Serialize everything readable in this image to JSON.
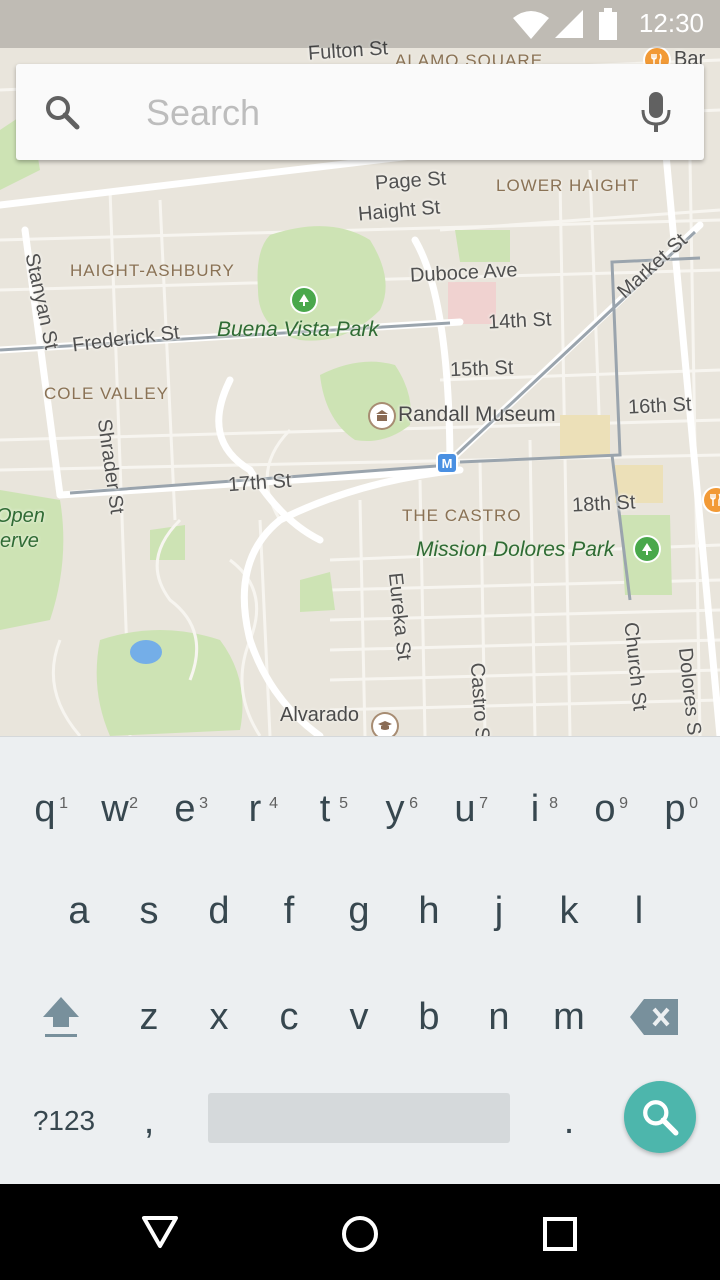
{
  "status_bar": {
    "time": "12:30",
    "icons": [
      "wifi-icon",
      "cell-signal-icon",
      "battery-icon"
    ]
  },
  "search": {
    "placeholder": "Search",
    "icons": [
      "search-icon",
      "mic-icon"
    ]
  },
  "map": {
    "streets": {
      "fulton": "Fulton St",
      "page": "Page St",
      "haight": "Haight St",
      "duboce": "Duboce Ave",
      "market": "Market St",
      "frederick": "Frederick St",
      "stanyan": "Stanyan St",
      "st14": "14th St",
      "st15": "15th St",
      "st16": "16th St",
      "st17": "17th St",
      "st18": "18th St",
      "shrader": "Shrader St",
      "eureka": "Eureka St",
      "castro": "Castro S",
      "church": "Church St",
      "dolores": "Dolores S"
    },
    "neighborhoods": {
      "alamo": "ALAMO SQUARE",
      "lower_haight": "LOWER HAIGHT",
      "haight_ashbury": "HAIGHT-ASHBURY",
      "cole_valley": "COLE VALLEY",
      "the_castro": "THE CASTRO"
    },
    "parks": {
      "buena_vista": "Buena Vista Park",
      "mission_dolores": "Mission Dolores Park"
    },
    "places": {
      "randall": "Randall Museum",
      "alvarado": "Alvarado",
      "bar": "Bar",
      "open_reserve_1": "Open",
      "open_reserve_2": "erve"
    },
    "colors": {
      "land": "#e9e5dc",
      "park": "#cde3b4",
      "water": "#74aee8",
      "road": "#ffffff",
      "pin_green": "#49a84b",
      "pin_orange": "#f29a36"
    }
  },
  "keyboard": {
    "row1": [
      {
        "label": "q",
        "hint": "1"
      },
      {
        "label": "w",
        "hint": "2"
      },
      {
        "label": "e",
        "hint": "3"
      },
      {
        "label": "r",
        "hint": "4"
      },
      {
        "label": "t",
        "hint": "5"
      },
      {
        "label": "y",
        "hint": "6"
      },
      {
        "label": "u",
        "hint": "7"
      },
      {
        "label": "i",
        "hint": "8"
      },
      {
        "label": "o",
        "hint": "9"
      },
      {
        "label": "p",
        "hint": "0"
      }
    ],
    "row2": [
      "a",
      "s",
      "d",
      "f",
      "g",
      "h",
      "j",
      "k",
      "l"
    ],
    "row3": [
      "z",
      "x",
      "c",
      "v",
      "b",
      "n",
      "m"
    ],
    "symbols_label": "?123",
    "comma_label": ",",
    "period_label": ".",
    "action_color": "#4db6ac",
    "icons": [
      "shift-icon",
      "backspace-icon",
      "search-action-icon"
    ]
  },
  "nav_bar": {
    "icons": [
      "back-icon",
      "home-icon",
      "recents-icon"
    ]
  }
}
